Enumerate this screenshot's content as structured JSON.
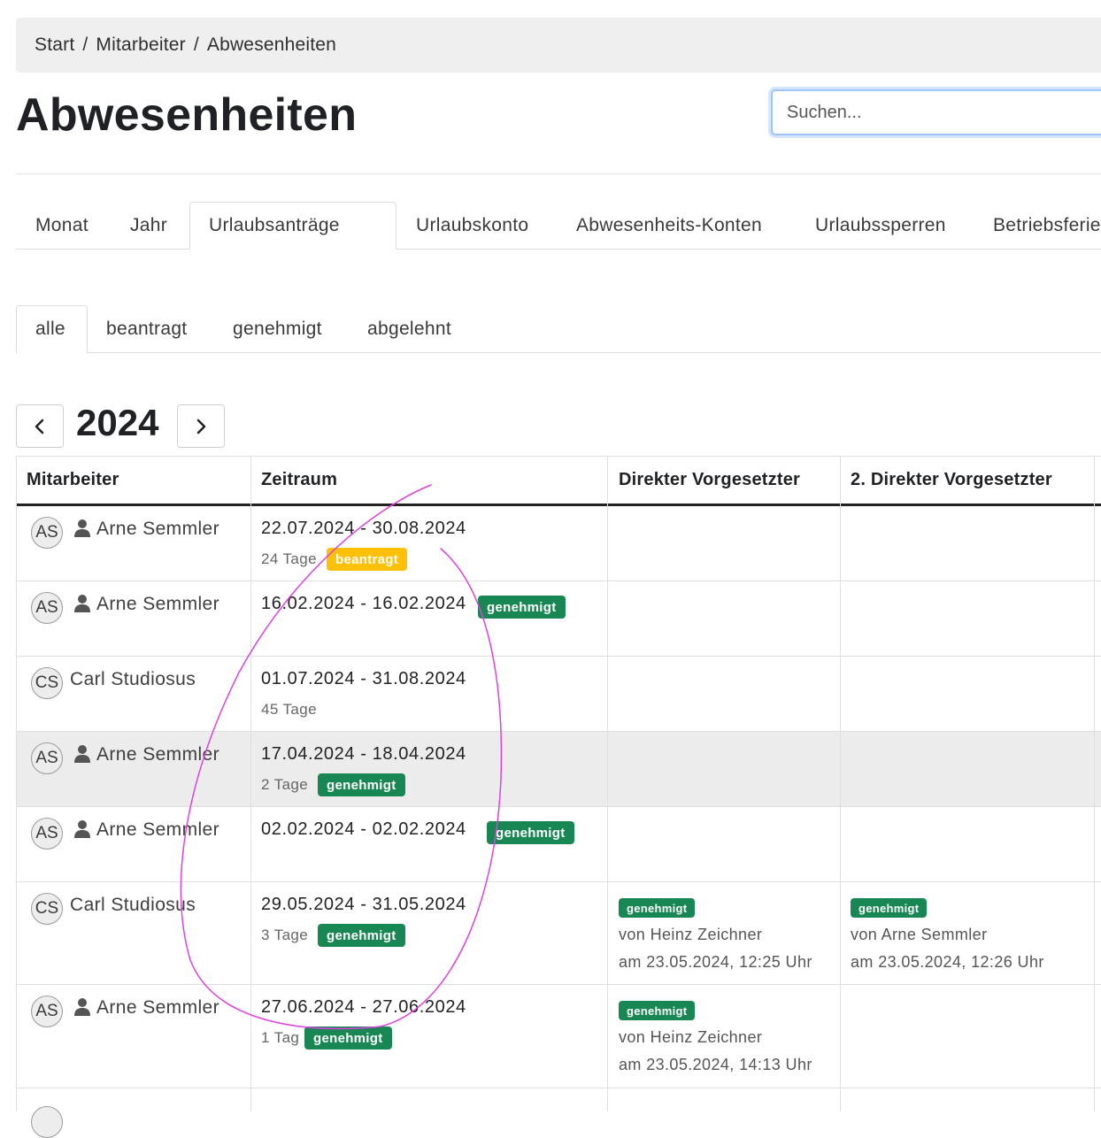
{
  "breadcrumb": {
    "items": [
      "Start",
      "Mitarbeiter",
      "Abwesenheiten"
    ],
    "separator": "/"
  },
  "page": {
    "title": "Abwesenheiten"
  },
  "search": {
    "placeholder": "Suchen..."
  },
  "tabs_main": [
    "Monat",
    "Jahr",
    "Urlaubsanträge",
    "Urlaubskonto",
    "Abwesenheits-Konten",
    "Urlaubssperren",
    "Betriebsferien"
  ],
  "tabs_main_active": "Urlaubsanträge",
  "tabs_sub": [
    "alle",
    "beantragt",
    "genehmigt",
    "abgelehnt"
  ],
  "tabs_sub_active": "alle",
  "year_nav": {
    "year": "2024",
    "prev_icon": "chevron-left-icon",
    "next_icon": "chevron-right-icon"
  },
  "table": {
    "headers": [
      "Mitarbeiter",
      "Zeitraum",
      "Direkter Vorgesetzter",
      "2. Direkter Vorgesetzter"
    ],
    "rows": [
      {
        "initials": "AS",
        "name": "Arne Semmler",
        "user_icon": true,
        "period": "22.07.2024 - 30.08.2024",
        "days": "24 Tage",
        "status": "beantragt"
      },
      {
        "initials": "AS",
        "name": "Arne Semmler",
        "user_icon": true,
        "period": "16.02.2024 - 16.02.2024",
        "status": "genehmigt"
      },
      {
        "initials": "CS",
        "name": "Carl Studiosus",
        "user_icon": false,
        "period": "01.07.2024 - 31.08.2024",
        "days": "45 Tage"
      },
      {
        "initials": "AS",
        "name": "Arne Semmler",
        "user_icon": true,
        "period": "17.04.2024 - 18.04.2024",
        "days": "2 Tage",
        "status": "genehmigt",
        "highlighted": true
      },
      {
        "initials": "AS",
        "name": "Arne Semmler",
        "user_icon": true,
        "period": "02.02.2024 - 02.02.2024",
        "status": "genehmigt"
      },
      {
        "initials": "CS",
        "name": "Carl Studiosus",
        "user_icon": false,
        "period": "29.05.2024 - 31.05.2024",
        "days": "3 Tage",
        "status": "genehmigt",
        "approver1": {
          "status": "genehmigt",
          "by": "von Heinz Zeichner",
          "at": "am 23.05.2024, 12:25 Uhr"
        },
        "approver2": {
          "status": "genehmigt",
          "by": "von Arne Semmler",
          "at": "am 23.05.2024, 12:26 Uhr"
        }
      },
      {
        "initials": "AS",
        "name": "Arne Semmler",
        "user_icon": true,
        "period": "27.06.2024 - 27.06.2024",
        "days": "1 Tag",
        "status": "genehmigt",
        "approver1": {
          "status": "genehmigt",
          "by": "von Heinz Zeichner",
          "at": "am 23.05.2024, 14:13 Uhr"
        }
      }
    ]
  },
  "colors": {
    "approved": "#198754",
    "requested": "#ffc107",
    "focus_ring": "#9ec5fe",
    "scribble": "#e040e0",
    "row_highlight": "#ececec"
  }
}
